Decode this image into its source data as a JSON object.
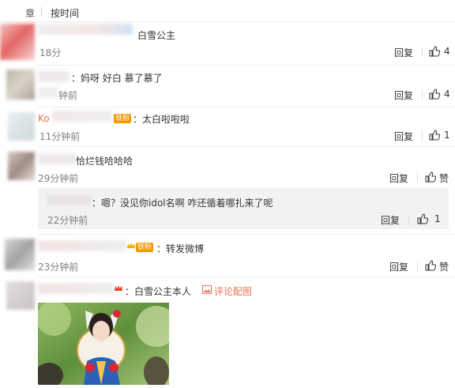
{
  "header": {
    "sort_partial": "章",
    "sort_label": "按时间"
  },
  "comments": [
    {
      "text": "白雪公主",
      "time": "18分",
      "reply_label": "回复",
      "like_count": "4"
    },
    {
      "text": "：妈呀 好白 慕了慕了",
      "time": "钟前",
      "reply_label": "回复",
      "like_count": "4"
    },
    {
      "name_partial": "Ko",
      "badge": "铁粉",
      "text": "：太白啦啦啦",
      "time": "11分钟前",
      "reply_label": "回复",
      "like_count": "1"
    },
    {
      "text": "恰烂钱哈哈哈",
      "time": "29分钟前",
      "reply_label": "回复",
      "like_label": "赞",
      "reply": {
        "text": "：嗯？没见你idol名啊 咋还循着哪扎来了呢",
        "time": "22分钟前",
        "reply_label": "回复",
        "like_count": "1"
      }
    },
    {
      "badge": "铁粉",
      "text": "：转发微博",
      "time": "23分钟前",
      "reply_label": "回复",
      "like_label": "赞"
    },
    {
      "text": "：白雪公主本人",
      "extra_link": "评论配图"
    }
  ],
  "colors": {
    "accent": "#eb7350",
    "badge": "#f39800",
    "muted": "#808080",
    "reply_bg": "#f2f2f5"
  },
  "icons": [
    "thumb-up-icon",
    "image-icon",
    "crown-icon"
  ]
}
